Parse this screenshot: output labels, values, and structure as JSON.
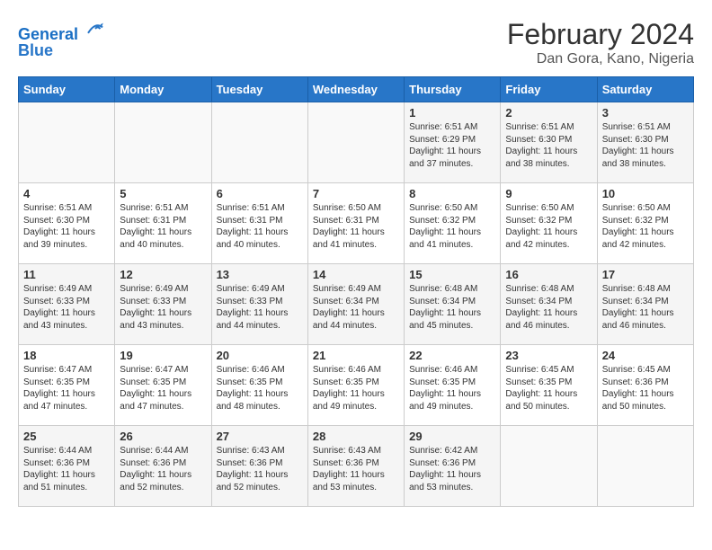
{
  "header": {
    "logo_line1": "General",
    "logo_line2": "Blue",
    "month": "February 2024",
    "location": "Dan Gora, Kano, Nigeria"
  },
  "days_of_week": [
    "Sunday",
    "Monday",
    "Tuesday",
    "Wednesday",
    "Thursday",
    "Friday",
    "Saturday"
  ],
  "weeks": [
    [
      {
        "day": "",
        "info": ""
      },
      {
        "day": "",
        "info": ""
      },
      {
        "day": "",
        "info": ""
      },
      {
        "day": "",
        "info": ""
      },
      {
        "day": "1",
        "info": "Sunrise: 6:51 AM\nSunset: 6:29 PM\nDaylight: 11 hours\nand 37 minutes."
      },
      {
        "day": "2",
        "info": "Sunrise: 6:51 AM\nSunset: 6:30 PM\nDaylight: 11 hours\nand 38 minutes."
      },
      {
        "day": "3",
        "info": "Sunrise: 6:51 AM\nSunset: 6:30 PM\nDaylight: 11 hours\nand 38 minutes."
      }
    ],
    [
      {
        "day": "4",
        "info": "Sunrise: 6:51 AM\nSunset: 6:30 PM\nDaylight: 11 hours\nand 39 minutes."
      },
      {
        "day": "5",
        "info": "Sunrise: 6:51 AM\nSunset: 6:31 PM\nDaylight: 11 hours\nand 40 minutes."
      },
      {
        "day": "6",
        "info": "Sunrise: 6:51 AM\nSunset: 6:31 PM\nDaylight: 11 hours\nand 40 minutes."
      },
      {
        "day": "7",
        "info": "Sunrise: 6:50 AM\nSunset: 6:31 PM\nDaylight: 11 hours\nand 41 minutes."
      },
      {
        "day": "8",
        "info": "Sunrise: 6:50 AM\nSunset: 6:32 PM\nDaylight: 11 hours\nand 41 minutes."
      },
      {
        "day": "9",
        "info": "Sunrise: 6:50 AM\nSunset: 6:32 PM\nDaylight: 11 hours\nand 42 minutes."
      },
      {
        "day": "10",
        "info": "Sunrise: 6:50 AM\nSunset: 6:32 PM\nDaylight: 11 hours\nand 42 minutes."
      }
    ],
    [
      {
        "day": "11",
        "info": "Sunrise: 6:49 AM\nSunset: 6:33 PM\nDaylight: 11 hours\nand 43 minutes."
      },
      {
        "day": "12",
        "info": "Sunrise: 6:49 AM\nSunset: 6:33 PM\nDaylight: 11 hours\nand 43 minutes."
      },
      {
        "day": "13",
        "info": "Sunrise: 6:49 AM\nSunset: 6:33 PM\nDaylight: 11 hours\nand 44 minutes."
      },
      {
        "day": "14",
        "info": "Sunrise: 6:49 AM\nSunset: 6:34 PM\nDaylight: 11 hours\nand 44 minutes."
      },
      {
        "day": "15",
        "info": "Sunrise: 6:48 AM\nSunset: 6:34 PM\nDaylight: 11 hours\nand 45 minutes."
      },
      {
        "day": "16",
        "info": "Sunrise: 6:48 AM\nSunset: 6:34 PM\nDaylight: 11 hours\nand 46 minutes."
      },
      {
        "day": "17",
        "info": "Sunrise: 6:48 AM\nSunset: 6:34 PM\nDaylight: 11 hours\nand 46 minutes."
      }
    ],
    [
      {
        "day": "18",
        "info": "Sunrise: 6:47 AM\nSunset: 6:35 PM\nDaylight: 11 hours\nand 47 minutes."
      },
      {
        "day": "19",
        "info": "Sunrise: 6:47 AM\nSunset: 6:35 PM\nDaylight: 11 hours\nand 47 minutes."
      },
      {
        "day": "20",
        "info": "Sunrise: 6:46 AM\nSunset: 6:35 PM\nDaylight: 11 hours\nand 48 minutes."
      },
      {
        "day": "21",
        "info": "Sunrise: 6:46 AM\nSunset: 6:35 PM\nDaylight: 11 hours\nand 49 minutes."
      },
      {
        "day": "22",
        "info": "Sunrise: 6:46 AM\nSunset: 6:35 PM\nDaylight: 11 hours\nand 49 minutes."
      },
      {
        "day": "23",
        "info": "Sunrise: 6:45 AM\nSunset: 6:35 PM\nDaylight: 11 hours\nand 50 minutes."
      },
      {
        "day": "24",
        "info": "Sunrise: 6:45 AM\nSunset: 6:36 PM\nDaylight: 11 hours\nand 50 minutes."
      }
    ],
    [
      {
        "day": "25",
        "info": "Sunrise: 6:44 AM\nSunset: 6:36 PM\nDaylight: 11 hours\nand 51 minutes."
      },
      {
        "day": "26",
        "info": "Sunrise: 6:44 AM\nSunset: 6:36 PM\nDaylight: 11 hours\nand 52 minutes."
      },
      {
        "day": "27",
        "info": "Sunrise: 6:43 AM\nSunset: 6:36 PM\nDaylight: 11 hours\nand 52 minutes."
      },
      {
        "day": "28",
        "info": "Sunrise: 6:43 AM\nSunset: 6:36 PM\nDaylight: 11 hours\nand 53 minutes."
      },
      {
        "day": "29",
        "info": "Sunrise: 6:42 AM\nSunset: 6:36 PM\nDaylight: 11 hours\nand 53 minutes."
      },
      {
        "day": "",
        "info": ""
      },
      {
        "day": "",
        "info": ""
      }
    ]
  ]
}
